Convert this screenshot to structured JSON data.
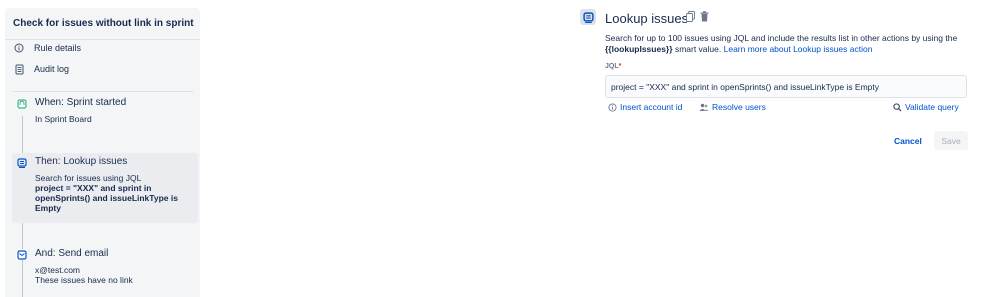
{
  "rule": {
    "title": "Check for issues without link in sprint"
  },
  "nav": {
    "rule_details": {
      "label": "Rule details",
      "icon": "info-icon"
    },
    "audit_log": {
      "label": "Audit log",
      "icon": "document-icon"
    }
  },
  "steps": [
    {
      "title": "When: Sprint started",
      "lines": [
        "In Sprint Board"
      ],
      "icon": "trigger-icon",
      "color": "#36b37e"
    },
    {
      "title": "Then: Lookup issues",
      "lines": [
        "Search for issues using JQL"
      ],
      "strong": "project = \"XXX\" and sprint in openSprints() and issueLinkType is Empty",
      "icon": "lookup-icon",
      "color": "#0052cc"
    },
    {
      "title": "And: Send email",
      "lines": [
        "x@test.com",
        "These issues have no link"
      ],
      "icon": "email-icon",
      "color": "#0052cc"
    }
  ],
  "editor": {
    "title": "Lookup issues",
    "icon": "lookup-icon",
    "copy_icon": "copy-icon",
    "delete_icon": "trash-icon",
    "desc_prefix": "Search for up to 100 issues using JQL and include the results list in other actions by using the",
    "smart_value": "{{lookupIssues}}",
    "desc_mid": "smart value.",
    "learn_more": "Learn more about Lookup issues action",
    "jql_label": "JQL",
    "jql_required": "*",
    "jql_value": "project = \"XXX\" and sprint in openSprints() and issueLinkType is Empty",
    "insert_account": "Insert account id",
    "resolve_users": "Resolve users",
    "validate_query": "Validate query",
    "cancel": "Cancel",
    "save": "Save"
  },
  "colors": {
    "link": "#0052cc",
    "panel_bg": "#f4f5f7",
    "selected_bg": "#ebecf0"
  }
}
